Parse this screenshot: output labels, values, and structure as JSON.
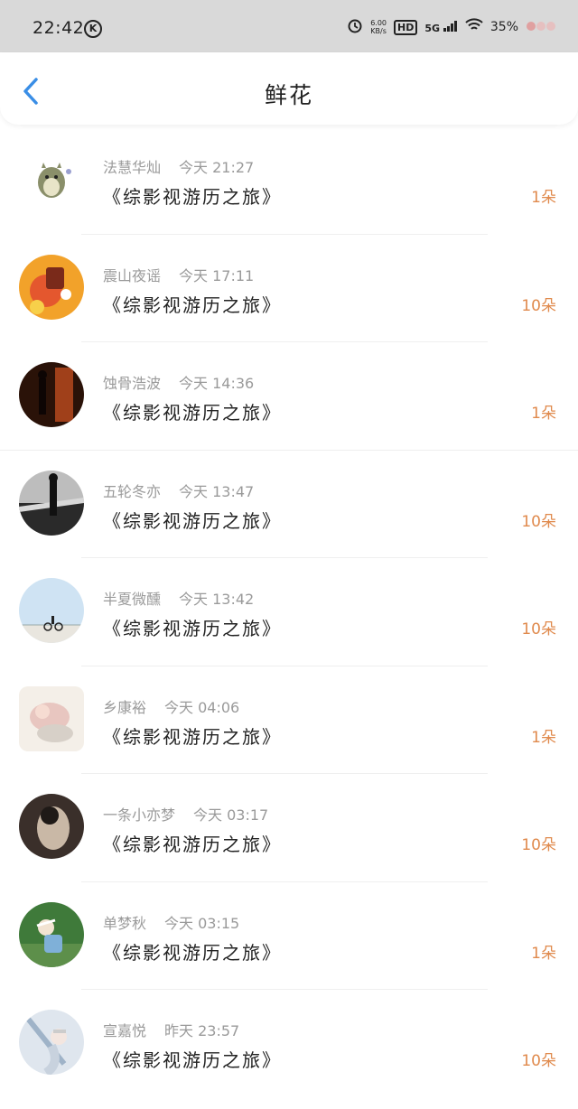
{
  "status_bar": {
    "time": "22:42",
    "k_icon": "k-app-icon",
    "net_speed_value": "6.00",
    "net_speed_unit": "KB/s",
    "hd": "HD",
    "network": "5G",
    "battery": "35%"
  },
  "nav": {
    "back_icon": "chevron-left-icon",
    "title": "鲜花"
  },
  "colors": {
    "accent": "#3a8ee6",
    "amount": "#e08a4d"
  },
  "items": [
    {
      "user": "法慧华灿",
      "time": "今天 21:27",
      "book": "《综影视游历之旅》",
      "amount": "1朵"
    },
    {
      "user": "震山夜谣",
      "time": "今天 17:11",
      "book": "《综影视游历之旅》",
      "amount": "10朵"
    },
    {
      "user": "蚀骨浩波",
      "time": "今天 14:36",
      "book": "《综影视游历之旅》",
      "amount": "1朵"
    },
    {
      "user": "五轮冬亦",
      "time": "今天 13:47",
      "book": "《综影视游历之旅》",
      "amount": "10朵"
    },
    {
      "user": "半夏微醺",
      "time": "今天 13:42",
      "book": "《综影视游历之旅》",
      "amount": "10朵"
    },
    {
      "user": "乡康裕",
      "time": "今天 04:06",
      "book": "《综影视游历之旅》",
      "amount": "1朵"
    },
    {
      "user": "一条小亦梦",
      "time": "今天 03:17",
      "book": "《综影视游历之旅》",
      "amount": "10朵"
    },
    {
      "user": "单梦秋",
      "time": "今天 03:15",
      "book": "《综影视游历之旅》",
      "amount": "1朵"
    },
    {
      "user": "宣嘉悦",
      "time": "昨天 23:57",
      "book": "《综影视游历之旅》",
      "amount": "10朵"
    }
  ]
}
